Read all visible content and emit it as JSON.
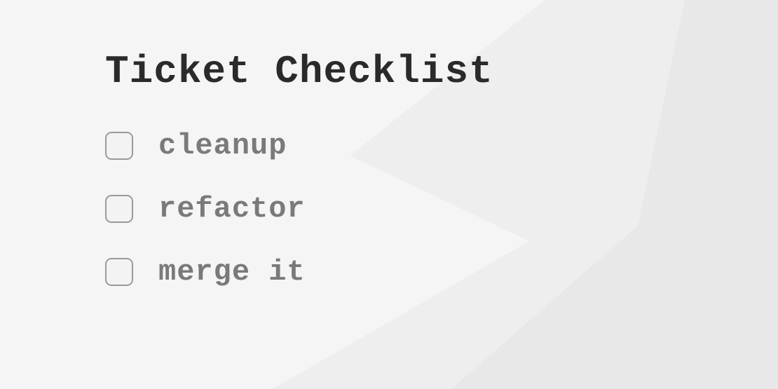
{
  "title": "Ticket Checklist",
  "items": [
    {
      "label": "cleanup",
      "checked": false
    },
    {
      "label": "refactor",
      "checked": false
    },
    {
      "label": "merge it",
      "checked": false
    }
  ]
}
